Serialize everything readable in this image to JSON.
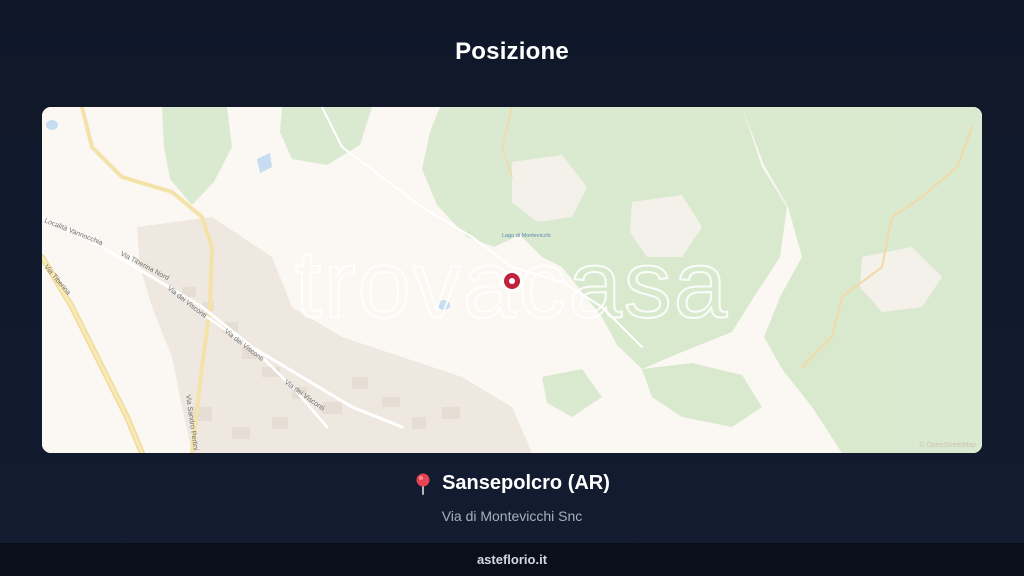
{
  "header": {
    "title": "Posizione"
  },
  "map": {
    "watermark": "trovacasa",
    "attribution": "© OpenStreetMap",
    "labels": {
      "localita": "Località Vannocchia",
      "tiberina_nord": "Via Tiberina Nord",
      "tiberina": "Via Tiberina",
      "visconti_1": "Via dei Visconti",
      "visconti_2": "Via dei Visconti",
      "visconti_3": "Via dei Visconti",
      "pertini": "Via Sandro Pertini",
      "lago": "Lago di Montevicchi"
    },
    "marker_icon": "map-marker-icon"
  },
  "location": {
    "pin_icon": "round-pushpin-icon",
    "city": "Sansepolcro (AR)",
    "address": "Via di Montevicchi Snc"
  },
  "footer": {
    "site": "asteflorio.it"
  },
  "colors": {
    "background": "#111a2d",
    "map_land": "#fbf7f2",
    "map_forest": "#d9ead0",
    "marker": "#c0223b"
  }
}
